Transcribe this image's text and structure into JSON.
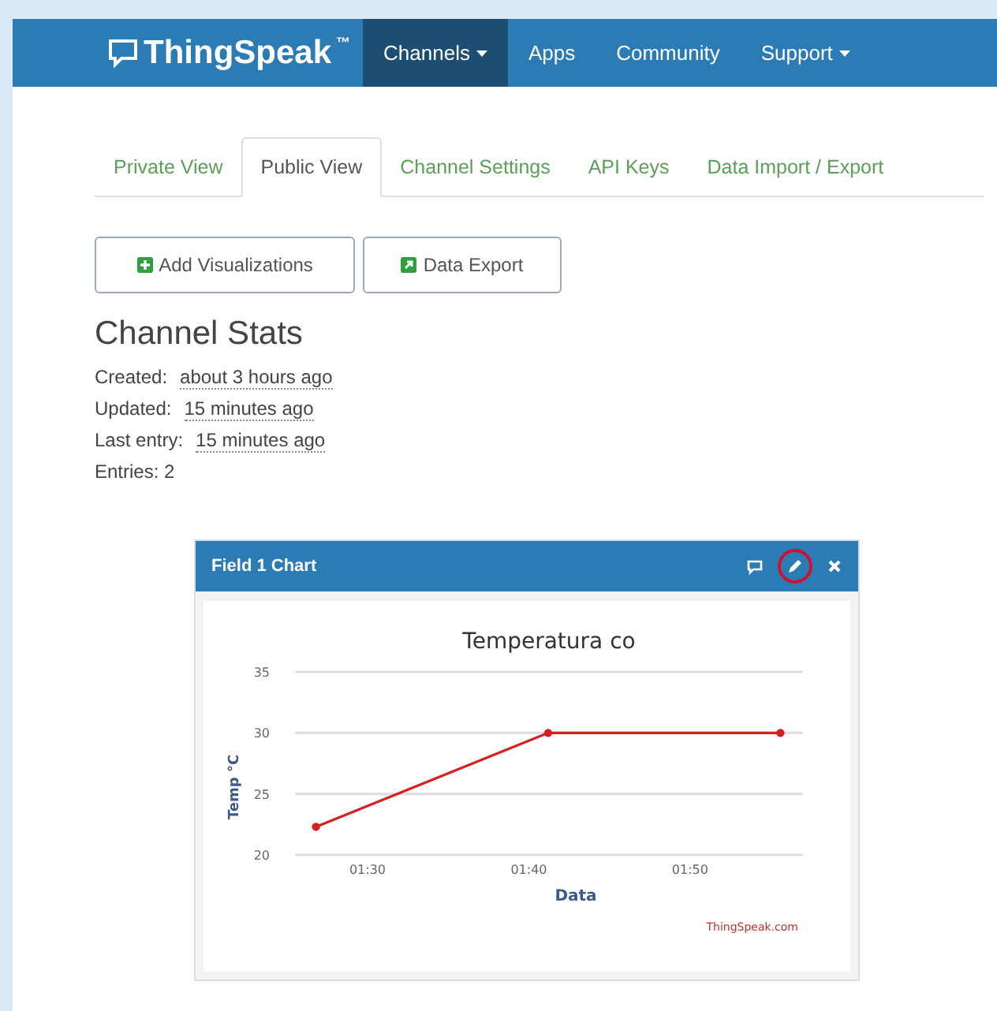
{
  "navbar": {
    "logo": "ThingSpeak",
    "trademark": "™",
    "items": [
      {
        "label": "Channels",
        "dropdown": true,
        "selected": true
      },
      {
        "label": "Apps",
        "dropdown": false,
        "selected": false
      },
      {
        "label": "Community",
        "dropdown": false,
        "selected": false
      },
      {
        "label": "Support",
        "dropdown": true,
        "selected": false
      }
    ]
  },
  "tabs": [
    {
      "label": "Private View",
      "selected": false
    },
    {
      "label": "Public View",
      "selected": true
    },
    {
      "label": "Channel Settings",
      "selected": false
    },
    {
      "label": "API Keys",
      "selected": false
    },
    {
      "label": "Data Import / Export",
      "selected": false
    }
  ],
  "buttons": [
    {
      "label": "Add Visualizations",
      "kind": "add"
    },
    {
      "label": "Data Export",
      "kind": "export"
    }
  ],
  "stats": {
    "title": "Channel Stats",
    "rows": [
      {
        "label": "Created:",
        "value": "about 3 hours ago"
      },
      {
        "label": "Updated:",
        "value": "15 minutes ago"
      },
      {
        "label": "Last entry:",
        "value": "15 minutes ago"
      },
      {
        "label": "Entries: 2"
      }
    ]
  },
  "widget": {
    "title": "Field 1 Chart",
    "edit_highlighted": true,
    "credit": "ThingSpeak.com",
    "chart_data": {
      "type": "line",
      "title": "Temperatura co",
      "xlabel": "Data",
      "ylabel": "Temp °C",
      "x": [
        86.8,
        101.2,
        115.6
      ],
      "series": [
        {
          "color": "#d62020",
          "marker": "circle",
          "values": [
            22.3,
            30,
            30
          ]
        }
      ],
      "xlim": [
        85.5,
        117
      ],
      "ylim": [
        20,
        35
      ],
      "xticks": [
        {
          "value": 90,
          "label": "01:30"
        },
        {
          "value": 100,
          "label": "01:40"
        },
        {
          "value": 110,
          "label": "01:50"
        }
      ],
      "yticks": [
        20,
        25,
        30,
        35
      ]
    }
  }
}
